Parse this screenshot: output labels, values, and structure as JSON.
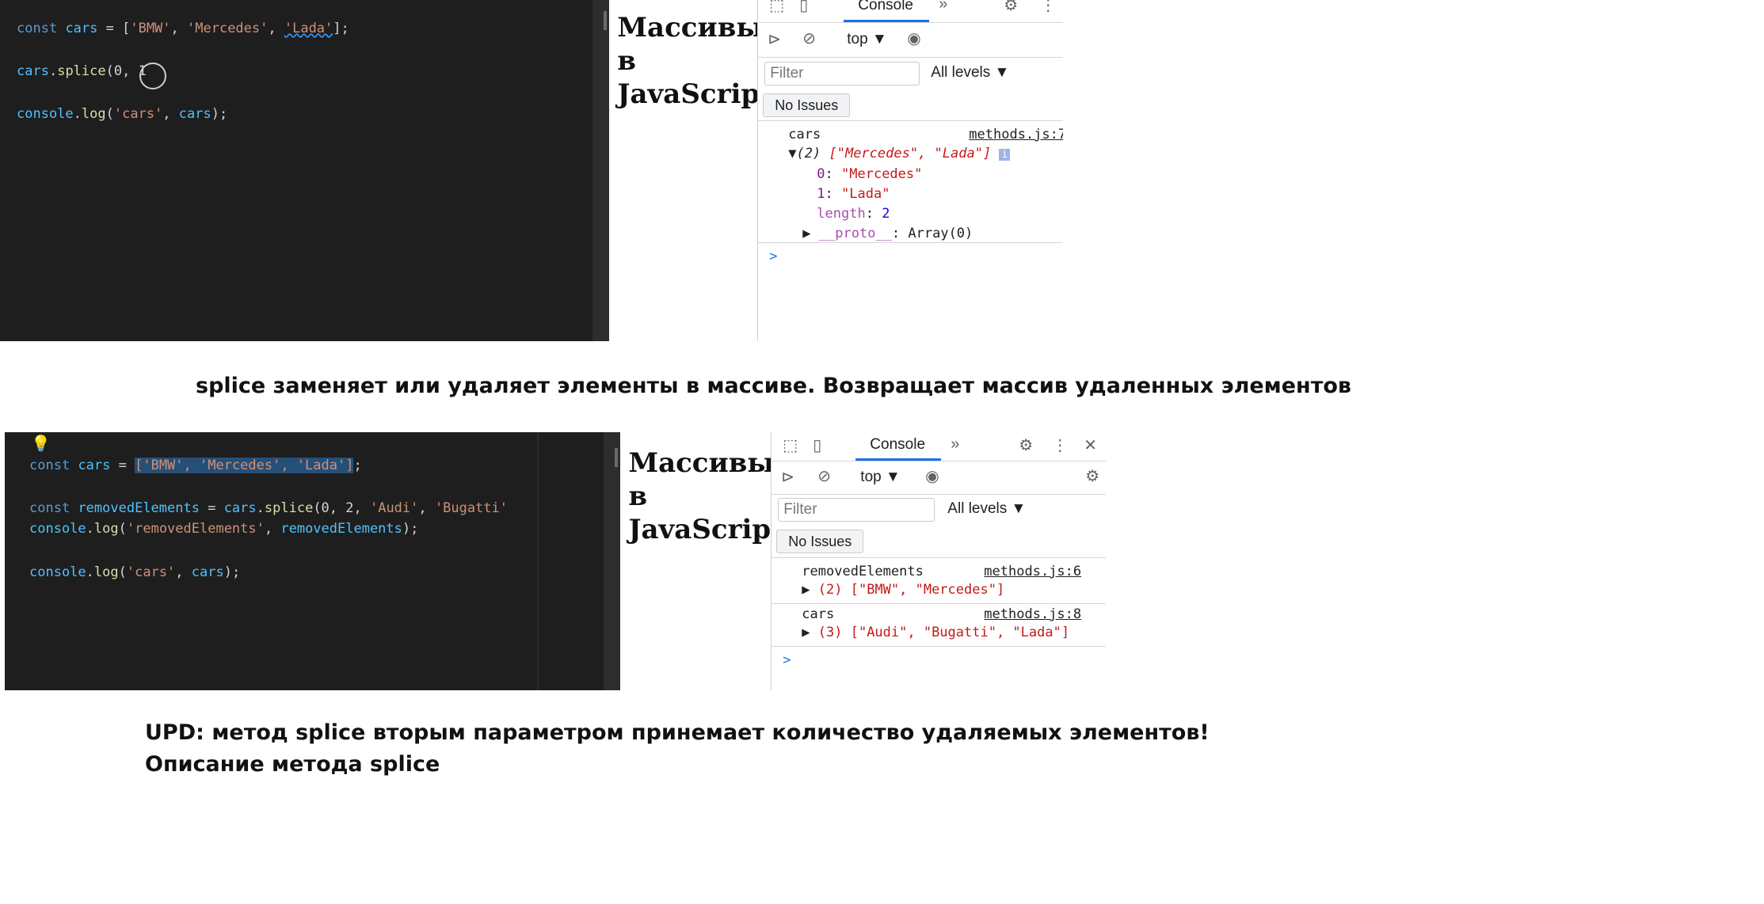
{
  "top_shot": {
    "code": {
      "line1": {
        "kw": "const",
        "var": "cars",
        "op": " = [",
        "s1": "'BMW'",
        "c1": ", ",
        "s2": "'Mercedes'",
        "c2": ", ",
        "s3": "'Lada'",
        "end": "];"
      },
      "line2": {
        "var": "cars",
        "dot": ".",
        "fn": "splice",
        "args": "(0, 1"
      },
      "line3": {
        "var": "console",
        "dot": ".",
        "fn": "log",
        "open": "(",
        "s": "'cars'",
        "c": ", ",
        "var2": "cars",
        "end": ");"
      }
    },
    "page_title": "Массивы\nв\nJavaScript",
    "devtools": {
      "tab": "Console",
      "context": "top ▼",
      "filter_placeholder": "Filter",
      "levels": "All levels ▼",
      "issues": "No Issues",
      "log_label": "cars",
      "log_source": "methods.js:7",
      "array_summary_count": "(2) ",
      "array_summary_items": "[\"Mercedes\", \"Lada\"]",
      "item0_key": "0",
      "item0_val": "\"Mercedes\"",
      "item1_key": "1",
      "item1_val": "\"Lada\"",
      "length_key": "length",
      "length_val": "2",
      "proto_key": "__proto__",
      "proto_val": "Array(0)",
      "prompt": ">"
    }
  },
  "caption1": "splice заменяет или удаляет элементы в массиве. Возвращает массив удаленных элементов",
  "bottom_shot": {
    "code": {
      "line1": {
        "kw": "const",
        "var": "cars",
        "op": " = ",
        "sel": "['BMW', 'Mercedes', 'Lada']",
        "end": ";"
      },
      "line2": {
        "kw": "const",
        "var": "removedElements",
        "op": " = ",
        "var2": "cars",
        "dot": ".",
        "fn": "splice",
        "args": "(0, 2, ",
        "s1": "'Audi'",
        "c": ", ",
        "s2": "'Bugatti'"
      },
      "line3": {
        "var": "console",
        "dot": ".",
        "fn": "log",
        "open": "(",
        "s": "'removedElements'",
        "c": ", ",
        "var2": "removedElements",
        "end": ");"
      },
      "line4": {
        "var": "console",
        "dot": ".",
        "fn": "log",
        "open": "(",
        "s": "'cars'",
        "c": ", ",
        "var2": "cars",
        "end": ");"
      }
    },
    "page_title": "Массивы\nв\nJavaScript",
    "devtools": {
      "tab": "Console",
      "context": "top ▼",
      "filter_placeholder": "Filter",
      "levels": "All levels ▼",
      "issues": "No Issues",
      "log1_label": "removedElements",
      "log1_source": "methods.js:6",
      "log1_value": "(2) [\"BMW\", \"Mercedes\"]",
      "log2_label": "cars",
      "log2_source": "methods.js:8",
      "log2_value": "(3) [\"Audi\", \"Bugatti\", \"Lada\"]",
      "prompt": ">"
    }
  },
  "caption2_line1": "UPD: метод splice вторым параметром принемает количество удаляемых элементов!",
  "caption2_line2": "Описание метода splice",
  "colors": {
    "accent": "#1a73e8",
    "editor_bg": "#1e1e1e",
    "string": "#ce9178",
    "keyword": "#569cd6"
  }
}
